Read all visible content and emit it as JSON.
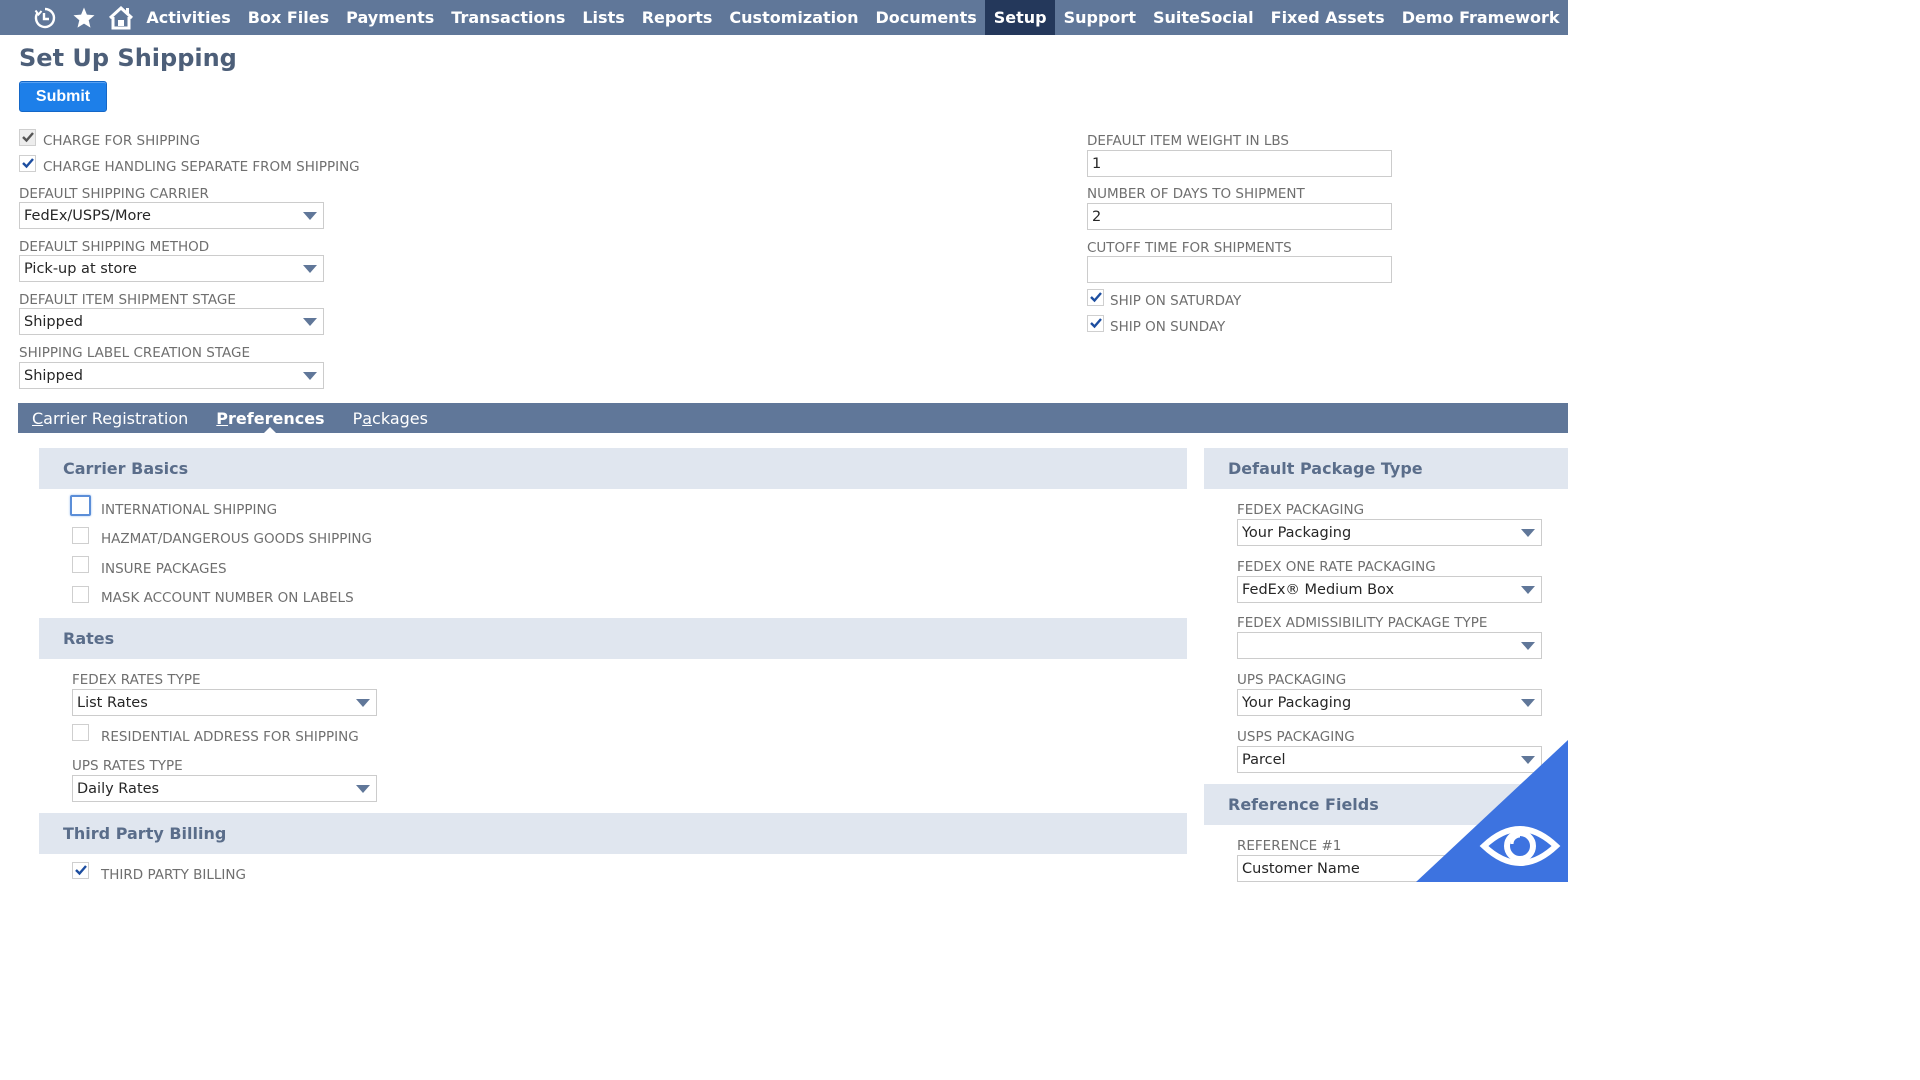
{
  "nav": {
    "icons": [
      "recent-records-icon",
      "favorites-star-icon",
      "home-icon"
    ],
    "items": [
      {
        "label": "Activities",
        "active": false
      },
      {
        "label": "Box Files",
        "active": false
      },
      {
        "label": "Payments",
        "active": false
      },
      {
        "label": "Transactions",
        "active": false
      },
      {
        "label": "Lists",
        "active": false
      },
      {
        "label": "Reports",
        "active": false
      },
      {
        "label": "Customization",
        "active": false
      },
      {
        "label": "Documents",
        "active": false
      },
      {
        "label": "Setup",
        "active": true
      },
      {
        "label": "Support",
        "active": false
      },
      {
        "label": "SuiteSocial",
        "active": false
      },
      {
        "label": "Fixed Assets",
        "active": false
      },
      {
        "label": "Demo Framework",
        "active": false
      }
    ]
  },
  "page": {
    "title": "Set Up Shipping",
    "submit_label": "Submit"
  },
  "main_left": {
    "charge_for_shipping": {
      "label": "CHARGE FOR SHIPPING",
      "checked": true,
      "disabled": true
    },
    "charge_handling": {
      "label": "CHARGE HANDLING SEPARATE FROM SHIPPING",
      "checked": true
    },
    "default_carrier": {
      "label": "DEFAULT SHIPPING CARRIER",
      "value": "FedEx/USPS/More"
    },
    "default_method": {
      "label": "DEFAULT SHIPPING METHOD",
      "value": "Pick-up at store"
    },
    "item_shipment_stage": {
      "label": "DEFAULT ITEM SHIPMENT STAGE",
      "value": "Shipped"
    },
    "label_creation_stage": {
      "label": "SHIPPING LABEL CREATION STAGE",
      "value": "Shipped"
    }
  },
  "main_right": {
    "item_weight": {
      "label": "DEFAULT ITEM WEIGHT IN LBS",
      "value": "1"
    },
    "days_to_shipment": {
      "label": "NUMBER OF DAYS TO SHIPMENT",
      "value": "2"
    },
    "cutoff_time": {
      "label": "CUTOFF TIME FOR SHIPMENTS",
      "value": ""
    },
    "ship_saturday": {
      "label": "SHIP ON SATURDAY",
      "checked": true
    },
    "ship_sunday": {
      "label": "SHIP ON SUNDAY",
      "checked": true
    }
  },
  "subtabs": [
    {
      "label_accel": "C",
      "label_rest": "arrier Registration",
      "active": false
    },
    {
      "label_accel": "P",
      "label_rest": "references",
      "active": true
    },
    {
      "label_pre": "P",
      "label_accel": "a",
      "label_rest": "ckages",
      "active": false
    }
  ],
  "carrier_basics": {
    "title": "Carrier Basics",
    "international": {
      "label": "INTERNATIONAL SHIPPING",
      "checked": false,
      "focused": true
    },
    "hazmat": {
      "label": "HAZMAT/DANGEROUS GOODS SHIPPING",
      "checked": false
    },
    "insure": {
      "label": "INSURE PACKAGES",
      "checked": false
    },
    "mask_account": {
      "label": "MASK ACCOUNT NUMBER ON LABELS",
      "checked": false
    }
  },
  "rates": {
    "title": "Rates",
    "fedex_rates_type": {
      "label": "FEDEX RATES TYPE",
      "value": "List Rates"
    },
    "residential": {
      "label": "RESIDENTIAL ADDRESS FOR SHIPPING",
      "checked": false
    },
    "ups_rates_type": {
      "label": "UPS RATES TYPE",
      "value": "Daily Rates"
    }
  },
  "third_party": {
    "title": "Third Party Billing",
    "billing": {
      "label": "THIRD PARTY BILLING",
      "checked": true
    }
  },
  "default_package": {
    "title": "Default Package Type",
    "fedex_packaging": {
      "label": "FEDEX PACKAGING",
      "value": "Your Packaging"
    },
    "fedex_one_rate": {
      "label": "FEDEX ONE RATE PACKAGING",
      "value": "FedEx® Medium Box"
    },
    "fedex_admissibility": {
      "label": "FEDEX ADMISSIBILITY PACKAGE TYPE",
      "value": ""
    },
    "ups_packaging": {
      "label": "UPS PACKAGING",
      "value": "Your Packaging"
    },
    "usps_packaging": {
      "label": "USPS PACKAGING",
      "value": "Parcel"
    }
  },
  "reference_fields": {
    "title": "Reference Fields",
    "ref1": {
      "label": "REFERENCE #1",
      "value": "Customer Name"
    }
  },
  "colors": {
    "nav_bg": "#607799",
    "nav_active": "#24385b",
    "submit_blue": "#1d7fe9",
    "section_bg": "#e0e6ef",
    "overlay_blue": "#3d73e0"
  }
}
